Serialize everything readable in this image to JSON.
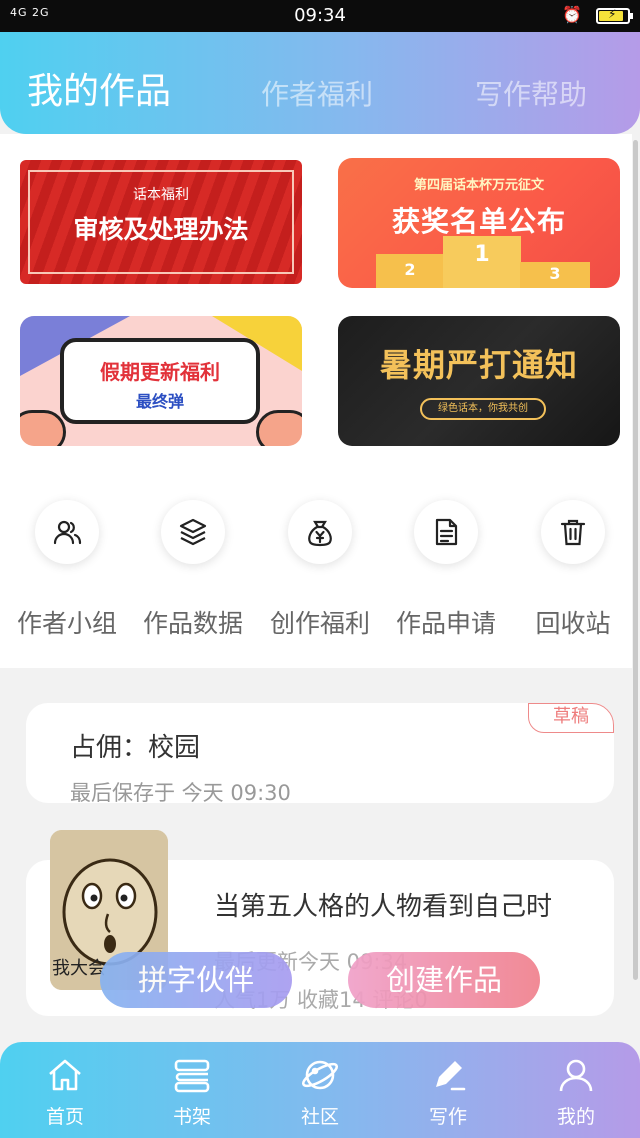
{
  "status_bar": {
    "signal": "4G 2G",
    "time": "09:34"
  },
  "header": {
    "tabs": [
      "我的作品",
      "作者福利",
      "写作帮助"
    ],
    "active_tab": "我的作品"
  },
  "banners": [
    {
      "small": "话本福利",
      "big": "审核及处理办法"
    },
    {
      "small": "第四届话本杯万元征文",
      "big": "获奖名单公布",
      "podium": [
        "2",
        "1",
        "3"
      ]
    },
    {
      "line1": "假期更新福利",
      "line2": "最终弹"
    },
    {
      "big": "暑期严打通知",
      "pill": "绿色话本，你我共创"
    }
  ],
  "shortcuts": [
    {
      "label": "作者小组",
      "icon": "users-icon"
    },
    {
      "label": "作品数据",
      "icon": "layers-icon"
    },
    {
      "label": "创作福利",
      "icon": "money-bag-icon"
    },
    {
      "label": "作品申请",
      "icon": "document-icon"
    },
    {
      "label": "回收站",
      "icon": "trash-icon"
    }
  ],
  "draft": {
    "tag": "草稿",
    "title": "占佣：校园",
    "saved": "最后保存于 今天 09:30"
  },
  "work": {
    "title": "当第五人格的人物看到自己时",
    "updated": "最后更新今天 09:34",
    "stats": "人气1万  收藏14  评论0",
    "cover_text": "我大会"
  },
  "floating_buttons": {
    "partner": "拼字伙伴",
    "create": "创建作品"
  },
  "tabbar": [
    {
      "label": "首页",
      "icon": "home-icon"
    },
    {
      "label": "书架",
      "icon": "bookshelf-icon"
    },
    {
      "label": "社区",
      "icon": "planet-icon"
    },
    {
      "label": "写作",
      "icon": "pen-icon"
    },
    {
      "label": "我的",
      "icon": "user-icon"
    }
  ],
  "colors": {
    "header_gradient_start": "#4fd0f0",
    "header_gradient_end": "#b59be8",
    "draft_tag": "#ee7d7d"
  }
}
